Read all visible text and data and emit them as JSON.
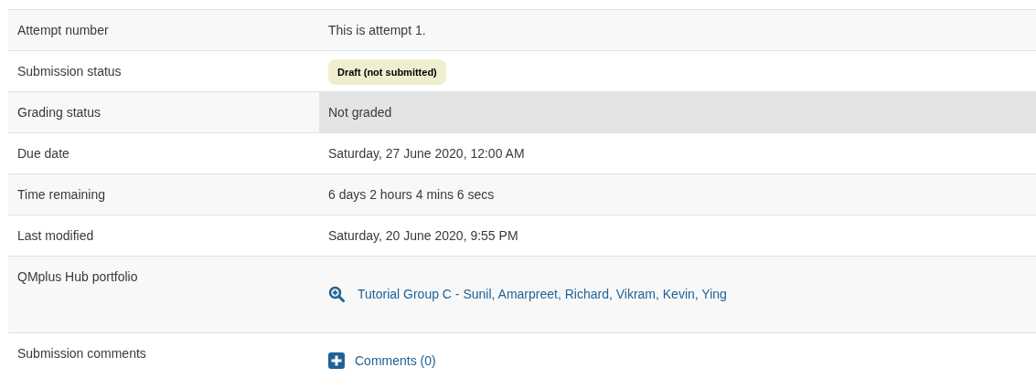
{
  "rows": [
    {
      "kind": "text",
      "label": "Attempt number",
      "value": "This is attempt 1.",
      "highlighted": false
    },
    {
      "kind": "badge",
      "label": "Submission status",
      "value": "Draft (not submitted)",
      "highlighted": false
    },
    {
      "kind": "text",
      "label": "Grading status",
      "value": "Not graded",
      "highlighted": true
    },
    {
      "kind": "text",
      "label": "Due date",
      "value": "Saturday, 27 June 2020, 12:00 AM",
      "highlighted": false
    },
    {
      "kind": "text",
      "label": "Time remaining",
      "value": "6 days 2 hours 4 mins 6 secs",
      "highlighted": false
    },
    {
      "kind": "text",
      "label": "Last modified",
      "value": "Saturday, 20 June 2020, 9:55 PM",
      "highlighted": false
    },
    {
      "kind": "link",
      "label": "QMplus Hub portfolio",
      "value": "Tutorial Group C - Sunil, Amarpreet, Richard, Vikram, Kevin, Ying",
      "highlighted": false
    },
    {
      "kind": "comments",
      "label": "Submission comments",
      "value": "Comments (0)",
      "highlighted": false
    }
  ]
}
